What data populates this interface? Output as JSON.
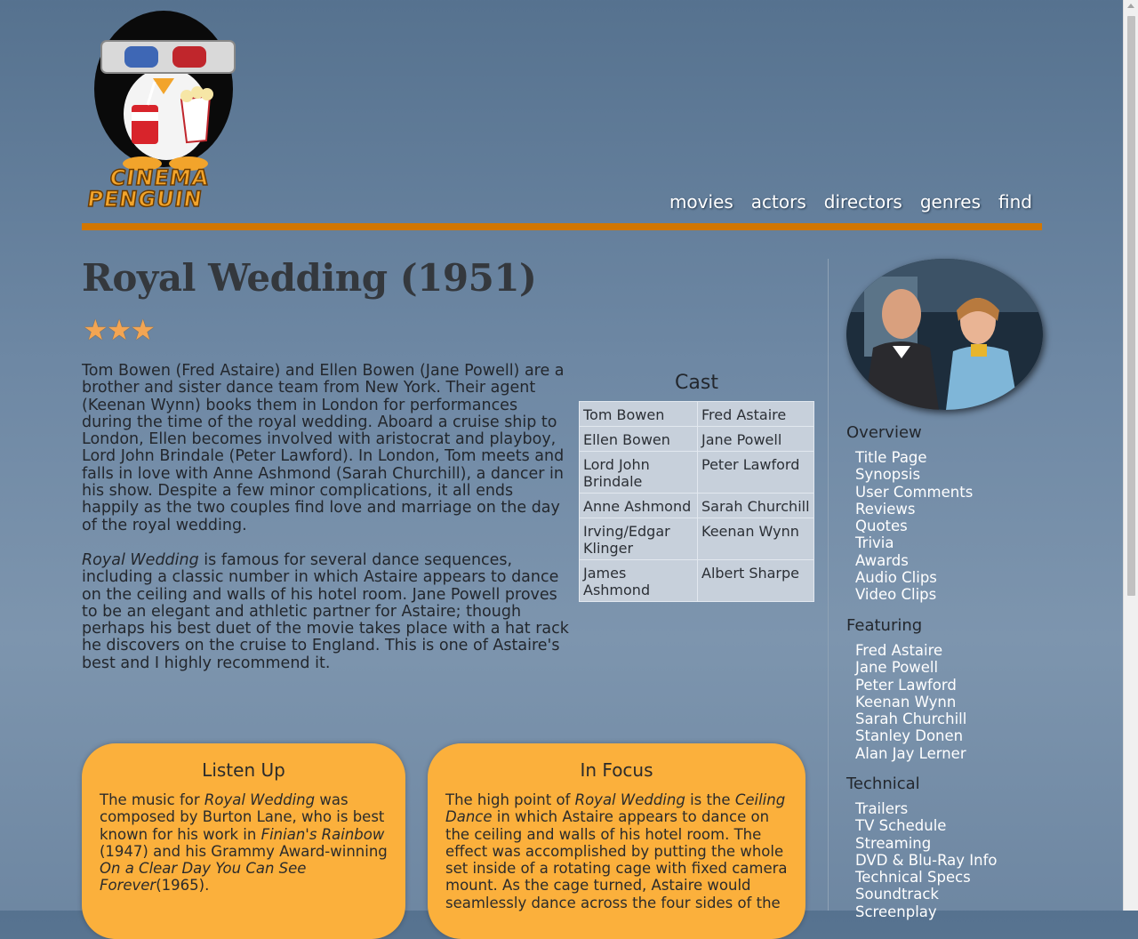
{
  "logo": {
    "line1": "CINEMA",
    "line2": "PENGUIN"
  },
  "nav": [
    "movies",
    "actors",
    "directors",
    "genres",
    "find"
  ],
  "movie": {
    "title": "Royal Wedding (1951)",
    "rating_stars": 3,
    "stars_text": "★★★"
  },
  "synopsis": {
    "p1": "Tom Bowen (Fred Astaire) and Ellen Bowen (Jane Powell) are a brother and sister dance team from New York. Their agent (Keenan Wynn) books them in London for performances during the time of the royal wedding. Aboard a cruise ship to London, Ellen becomes involved with aristocrat and playboy, Lord John Brindale (Peter Lawford). In London, Tom meets and falls in love with Anne Ashmond (Sarah Churchill), a dancer in his show. Despite a few minor complications, it all ends happily as the two couples find love and marriage on the day of the royal wedding.",
    "p2_italic": "Royal Wedding",
    "p2_rest": " is famous for several dance sequences, including a classic number in which Astaire appears to dance on the ceiling and walls of his hotel room. Jane Powell proves to be an elegant and athletic partner for Astaire; though perhaps his best duet of the movie takes place with a hat rack he discovers on the cruise to England. This is one of Astaire's best and I highly recommend it."
  },
  "cast": {
    "heading": "Cast",
    "rows": [
      [
        "Tom Bowen",
        "Fred Astaire"
      ],
      [
        "Ellen Bowen",
        "Jane Powell"
      ],
      [
        "Lord John Brindale",
        "Peter Lawford"
      ],
      [
        "Anne Ashmond",
        "Sarah Churchill"
      ],
      [
        "Irving/Edgar Klinger",
        "Keenan Wynn"
      ],
      [
        "James Ashmond",
        "Albert Sharpe"
      ]
    ]
  },
  "listen_up": {
    "heading": "Listen Up",
    "t1": "The music for ",
    "i1": "Royal Wedding",
    "t2": " was composed by Burton Lane, who is best known for his work in ",
    "i2": "Finian's Rainbow",
    "t3": " (1947) and his Grammy Award-winning ",
    "i3": "On a Clear Day You Can See Forever",
    "t4": "(1965)."
  },
  "in_focus": {
    "heading": "In Focus",
    "t1": "The high point of ",
    "i1": "Royal Wedding",
    "t2": " is the ",
    "i2": "Ceiling Dance",
    "t3": " in which Astaire appears to dance on the ceiling and walls of his hotel room. The effect was accomplished by putting the whole set inside of a rotating cage with fixed camera mount. As the cage turned, Astaire would seamlessly dance across the four sides of the"
  },
  "sidebar": {
    "overview": {
      "heading": "Overview",
      "items": [
        "Title Page",
        "Synopsis",
        "User Comments",
        "Reviews",
        "Quotes",
        "Trivia",
        "Awards",
        "Audio Clips",
        "Video Clips"
      ]
    },
    "featuring": {
      "heading": "Featuring",
      "items": [
        "Fred Astaire",
        "Jane Powell",
        "Peter Lawford",
        "Keenan Wynn",
        "Sarah Churchill",
        "Stanley Donen",
        "Alan Jay Lerner"
      ]
    },
    "technical": {
      "heading": "Technical",
      "items": [
        "Trailers",
        "TV Schedule",
        "Streaming",
        "DVD & Blu-Ray Info",
        "Technical Specs",
        "Soundtrack",
        "Screenplay"
      ]
    }
  },
  "colors": {
    "accent": "#d27600",
    "box": "#fbb03c",
    "star": "#f3a553"
  }
}
